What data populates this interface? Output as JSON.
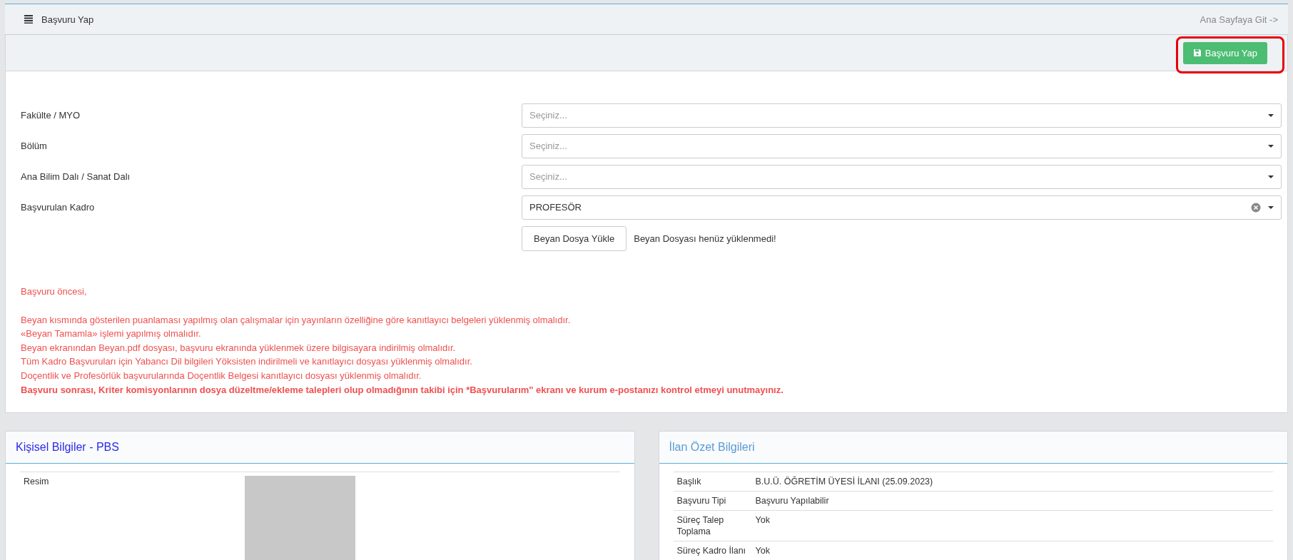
{
  "header": {
    "title": "Başvuru Yap",
    "home_link": "Ana Sayfaya Git ->"
  },
  "toolbar": {
    "submit_button": "Başvuru Yap",
    "highlighted": true
  },
  "form": {
    "fields": [
      {
        "label": "Fakülte / MYO",
        "placeholder": "Seçiniz...",
        "clearable": false
      },
      {
        "label": "Bölüm",
        "placeholder": "Seçiniz...",
        "clearable": false
      },
      {
        "label": "Ana Bilim Dalı / Sanat Dalı",
        "placeholder": "Seçiniz...",
        "clearable": false
      },
      {
        "label": "Başvurulan Kadro",
        "value": "PROFESÖR",
        "clearable": true
      }
    ],
    "upload": {
      "button": "Beyan Dosya Yükle",
      "status": "Beyan Dosyası henüz yüklenmedi!"
    }
  },
  "notice": {
    "intro": "Başvuru öncesi,",
    "items": [
      "Beyan kısmında gösterilen puanlaması yapılmış olan çalışmalar için yayınların özelliğine göre kanıtlayıcı belgeleri yüklenmiş olmalıdır.",
      "«Beyan Tamamla» işlemi yapılmış olmalıdır.",
      "Beyan ekranından Beyan.pdf dosyası, başvuru ekranında yüklenmek üzere bilgisayara indirilmiş olmalıdır.",
      "Tüm Kadro Başvuruları için Yabancı Dil bilgileri Yöksisten indirilmeli ve kanıtlayıcı dosyası yüklenmiş olmalıdır.",
      "Doçentlik ve Profesörlük başvurularında Doçentlik Belgesi kanıtlayıcı dosyası yüklenmiş olmalıdır."
    ],
    "footer": "Başvuru sonrası, Kriter komisyonlarının dosya düzeltme/ekleme talepleri olup olmadığının takibi için *Başvurularım\" ekranı ve kurum e-postanızı kontrol etmeyi unutmayınız."
  },
  "personal_panel": {
    "title": "Kişisel Bilgiler - PBS",
    "rows": [
      {
        "label": "Resim",
        "kind": "photo"
      }
    ]
  },
  "listing_panel": {
    "title": "İlan Özet Bilgileri",
    "rows": [
      {
        "label": "Başlık",
        "value": "B.U.Ü. ÖĞRETİM ÜYESİ İLANI (25.09.2023)"
      },
      {
        "label": "Başvuru Tipi",
        "value": "Başvuru Yapılabilir"
      },
      {
        "label": "Süreç Talep Toplama",
        "value": "Yok"
      },
      {
        "label": "Süreç Kadro İlanı",
        "value": "Yok"
      }
    ]
  }
}
